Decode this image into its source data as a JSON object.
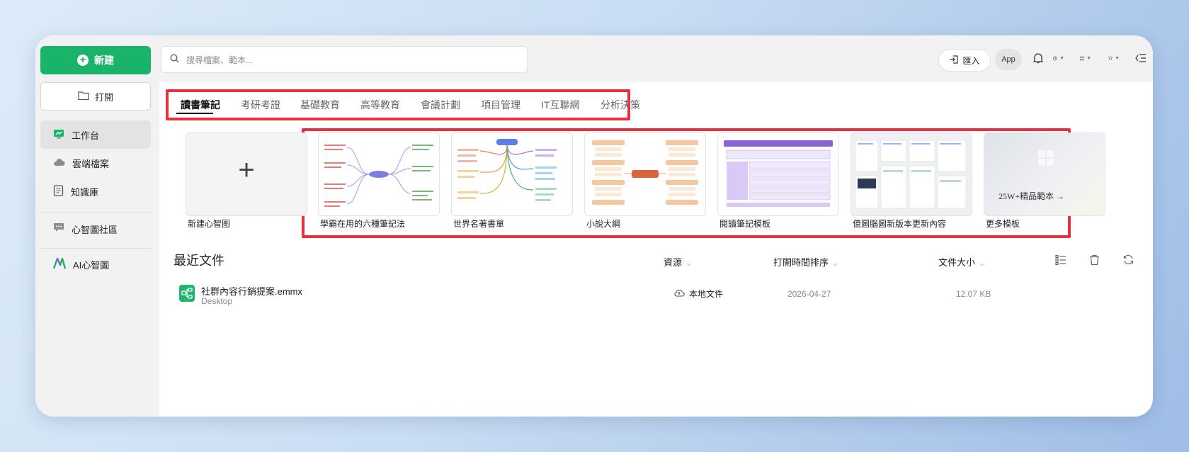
{
  "sidebar": {
    "new_label": "新建",
    "open_label": "打開",
    "items": [
      {
        "label": "工作台",
        "icon": "workspace-icon"
      },
      {
        "label": "雲端檔案",
        "icon": "cloud-icon"
      },
      {
        "label": "知識庫",
        "icon": "knowledge-base-icon"
      },
      {
        "label": "心智圖社區",
        "icon": "community-icon"
      },
      {
        "label": "AI心智圖",
        "icon": "ai-mindmap-icon"
      }
    ]
  },
  "topbar": {
    "search_placeholder": "搜尋檔案、範本...",
    "import_label": "匯入",
    "app_label": "App"
  },
  "tabs": [
    "讀書筆記",
    "考研考證",
    "基礎教育",
    "高等教育",
    "會議計劃",
    "項目管理",
    "IT互聯網",
    "分析決策"
  ],
  "templates": {
    "new_label": "新建心智图",
    "items": [
      "學霸在用的六種筆記法",
      "世界名著書單",
      "小說大綱",
      "閱讀筆記模板",
      "億圖腦圖新版本更新內容",
      "更多模板"
    ],
    "more_banner": "25W+精品範本 →"
  },
  "recent": {
    "title": "最近文件",
    "columns": {
      "source": "資源",
      "sort": "打開時間排序",
      "size": "文件大小"
    },
    "files": [
      {
        "name": "社群內容行銷提案.emmx",
        "location": "Desktop",
        "source": "本地文件",
        "date": "2026-04-27",
        "size": "12.07 KB"
      }
    ]
  },
  "colors": {
    "brand_green": "#19b46a",
    "highlight_red": "#e8303f"
  }
}
